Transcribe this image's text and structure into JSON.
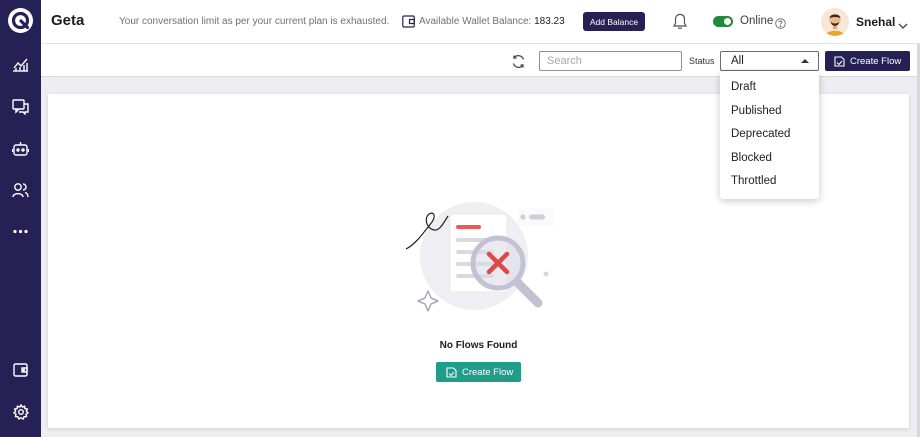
{
  "sidebar": {
    "logo": "g-logo-icon",
    "items": [
      {
        "icon": "analytics-icon"
      },
      {
        "icon": "chat-icon"
      },
      {
        "icon": "bot-icon"
      },
      {
        "icon": "users-icon"
      },
      {
        "icon": "more-icon"
      },
      {
        "icon": "wallet-icon"
      },
      {
        "icon": "settings-icon"
      }
    ]
  },
  "header": {
    "brand": "Geta",
    "limit_message": "Your conversation limit as per your current plan is exhausted.",
    "wallet_label": "Available Wallet Balance:",
    "wallet_amount": "183.23",
    "add_balance_label": "Add Balance",
    "status_text": "Online",
    "user_name": "Snehal"
  },
  "toolbar": {
    "search_placeholder": "Search",
    "status_label": "Status",
    "status_value": "All",
    "create_flow_label": "Create Flow"
  },
  "status_options": [
    "Draft",
    "Published",
    "Deprecated",
    "Blocked",
    "Throttled"
  ],
  "empty_state": {
    "message": "No Flows Found",
    "create_flow_label": "Create Flow"
  },
  "colors": {
    "sidebar": "#262155",
    "primary": "#262155",
    "teal": "#1f9c8a",
    "toggle_on": "#1f8a3c",
    "error": "#e04848"
  }
}
